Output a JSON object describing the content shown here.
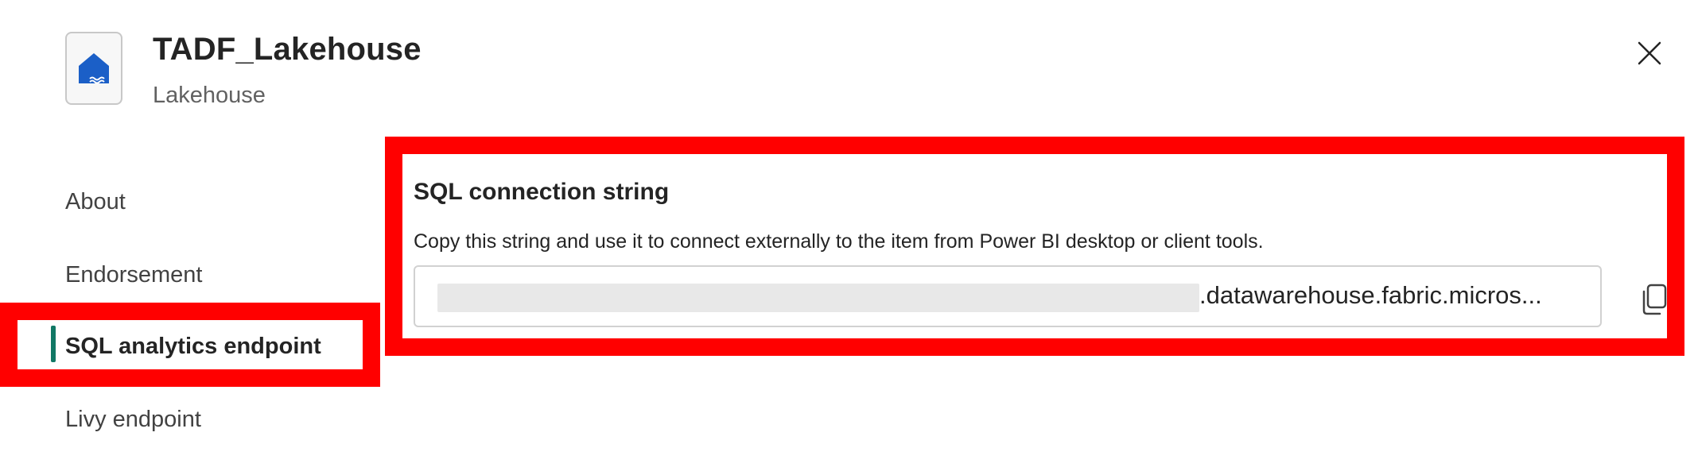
{
  "header": {
    "title": "TADF_Lakehouse",
    "subtitle": "Lakehouse",
    "icon": "lakehouse-icon",
    "close_icon": "close-icon"
  },
  "sidebar": {
    "items": [
      {
        "label": "About",
        "active": false
      },
      {
        "label": "Endorsement",
        "active": false
      },
      {
        "label": "SQL analytics endpoint",
        "active": true
      },
      {
        "label": "Livy endpoint",
        "active": false
      }
    ]
  },
  "panel": {
    "title": "SQL connection string",
    "description": "Copy this string and use it to connect externally to the item from Power BI desktop or client tools.",
    "connection_string_visible": ".datawarehouse.fabric.micros...",
    "copy_icon": "copy-icon"
  },
  "colors": {
    "accent": "#117865",
    "brand_icon": "#1b5fc7",
    "highlight": "#ff0000"
  }
}
